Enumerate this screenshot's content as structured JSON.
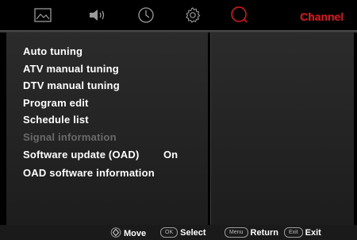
{
  "header": {
    "tabs": [
      {
        "icon": "picture-icon"
      },
      {
        "icon": "speaker-icon"
      },
      {
        "icon": "clock-icon"
      },
      {
        "icon": "gear-icon"
      },
      {
        "icon": "search-icon",
        "active": true
      }
    ],
    "title": "Channel",
    "accent_color": "#e8141c"
  },
  "menu": {
    "items": [
      {
        "label": "Auto tuning",
        "enabled": true
      },
      {
        "label": "ATV manual tuning",
        "enabled": true
      },
      {
        "label": "DTV manual tuning",
        "enabled": true
      },
      {
        "label": "Program edit",
        "enabled": true
      },
      {
        "label": "Schedule list",
        "enabled": true
      },
      {
        "label": "Signal information",
        "enabled": false
      },
      {
        "label": "Software update (OAD)",
        "enabled": true,
        "value": "On"
      },
      {
        "label": "OAD software information",
        "enabled": true
      }
    ]
  },
  "footer": {
    "move_label": "Move",
    "ok_key": "OK",
    "select_label": "Select",
    "menu_key": "Menu",
    "return_label": "Return",
    "exit_key": "Exit",
    "exit_label": "Exit"
  }
}
